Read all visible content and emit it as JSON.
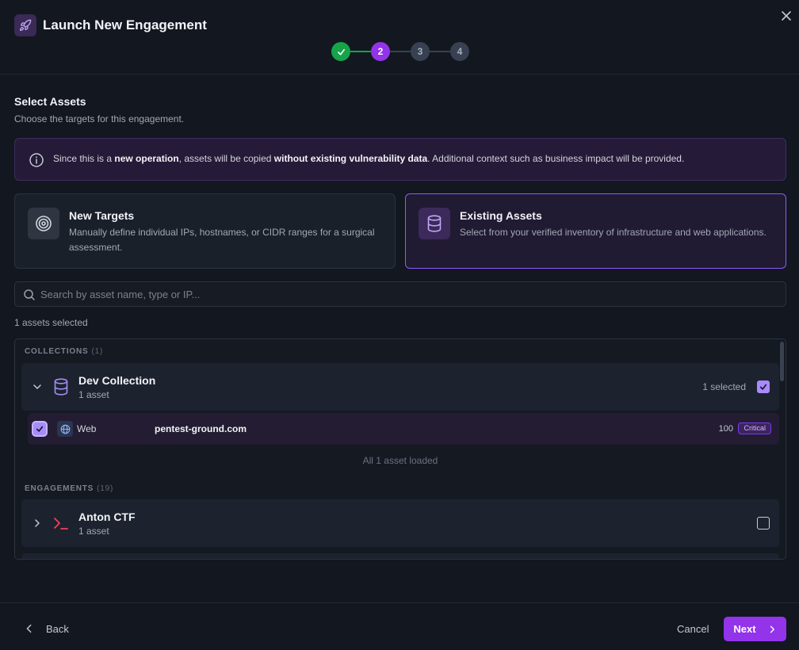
{
  "header": {
    "title": "Launch New Engagement",
    "app_icon": "rocket-icon",
    "close_icon": "close-icon"
  },
  "stepper": {
    "current": 2,
    "steps": [
      {
        "label": "",
        "status": "done"
      },
      {
        "label": "2",
        "status": "active"
      },
      {
        "label": "3",
        "status": "todo"
      },
      {
        "label": "4",
        "status": "todo"
      }
    ]
  },
  "section": {
    "title": "Select Assets",
    "subtitle": "Choose the targets for this engagement."
  },
  "info": {
    "icon": "info-icon",
    "part1": "Since this is a ",
    "bold1": "new operation",
    "part2": ", assets will be copied ",
    "bold2": "without existing vulnerability data",
    "part3": ". Additional context such as business impact will be provided."
  },
  "cards": [
    {
      "title": "New Targets",
      "description": "Manually define individual IPs, hostnames, or CIDR ranges for a surgical assessment.",
      "icon": "target-icon",
      "selected": false
    },
    {
      "title": "Existing Assets",
      "description": "Select from your verified inventory of infrastructure and web applications.",
      "icon": "database-icon",
      "selected": true
    }
  ],
  "search": {
    "placeholder": "Search by asset name, type or IP...",
    "value": ""
  },
  "selected_count": "1 assets selected",
  "collections": {
    "label": "COLLECTIONS",
    "count": "(1)",
    "items": [
      {
        "name": "Dev Collection",
        "count": "1 asset",
        "selected_text": "1 selected",
        "expanded": true,
        "checked": true,
        "assets": [
          {
            "type": "Web",
            "name": "pentest-ground.com",
            "score": "100",
            "severity": "Critical",
            "checked": true
          }
        ],
        "loaded_text": "All 1 asset loaded"
      }
    ]
  },
  "engagements": {
    "label": "ENGAGEMENTS",
    "count": "(19)",
    "items": [
      {
        "name": "Anton CTF",
        "count": "1 asset",
        "checked": false,
        "expanded": false
      }
    ]
  },
  "footer": {
    "back": "Back",
    "cancel": "Cancel",
    "next": "Next"
  },
  "colors": {
    "accent": "#9333ea",
    "success": "#16a34a",
    "background": "#121720"
  }
}
